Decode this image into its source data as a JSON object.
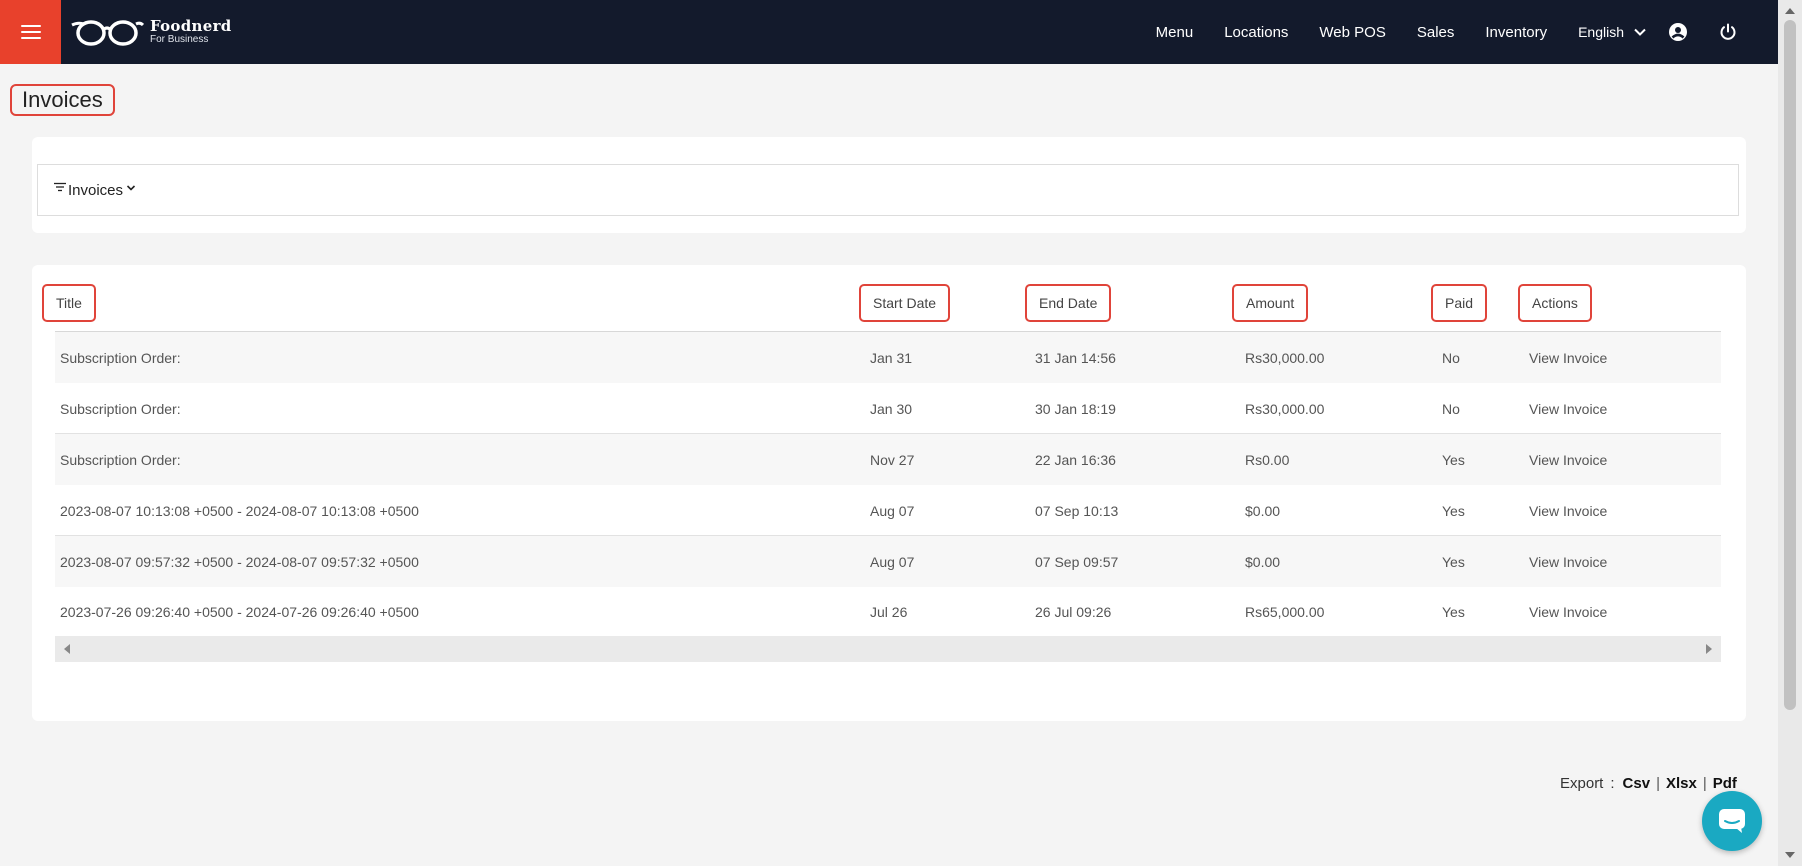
{
  "header": {
    "brand_name": "Foodnerd",
    "brand_sub": "For Business",
    "nav": [
      "Menu",
      "Locations",
      "Web POS",
      "Sales",
      "Inventory"
    ],
    "language": "English",
    "colors": {
      "bar": "#131a2c",
      "menu_button": "#e8412c"
    }
  },
  "page": {
    "title": "Invoices"
  },
  "filter": {
    "label": "Invoices"
  },
  "table": {
    "columns": [
      "Title",
      "Start Date",
      "End Date",
      "Amount",
      "Paid",
      "Actions"
    ],
    "rows": [
      {
        "title": "Subscription Order:",
        "start": "Jan 31",
        "end": "31 Jan 14:56",
        "amount": "Rs30,000.00",
        "paid": "No",
        "action": "View Invoice"
      },
      {
        "title": "Subscription Order:",
        "start": "Jan 30",
        "end": "30 Jan 18:19",
        "amount": "Rs30,000.00",
        "paid": "No",
        "action": "View Invoice"
      },
      {
        "title": "Subscription Order:",
        "start": "Nov 27",
        "end": "22 Jan 16:36",
        "amount": "Rs0.00",
        "paid": "Yes",
        "action": "View Invoice"
      },
      {
        "title": "2023-08-07 10:13:08 +0500 - 2024-08-07 10:13:08 +0500",
        "start": "Aug 07",
        "end": "07 Sep 10:13",
        "amount": "$0.00",
        "paid": "Yes",
        "action": "View Invoice"
      },
      {
        "title": "2023-08-07 09:57:32 +0500 - 2024-08-07 09:57:32 +0500",
        "start": "Aug 07",
        "end": "07 Sep 09:57",
        "amount": "$0.00",
        "paid": "Yes",
        "action": "View Invoice"
      },
      {
        "title": "2023-07-26 09:26:40 +0500 - 2024-07-26 09:26:40 +0500",
        "start": "Jul 26",
        "end": "26 Jul 09:26",
        "amount": "Rs65,000.00",
        "paid": "Yes",
        "action": "View Invoice"
      }
    ]
  },
  "export": {
    "label": "Export",
    "colon": ":",
    "options": [
      "Csv",
      "Xlsx",
      "Pdf"
    ],
    "separator": "|"
  },
  "icons": [
    "hamburger-icon",
    "glasses-logo-icon",
    "chevron-down-icon",
    "user-circle-icon",
    "power-icon",
    "filter-icon",
    "chat-icon"
  ]
}
